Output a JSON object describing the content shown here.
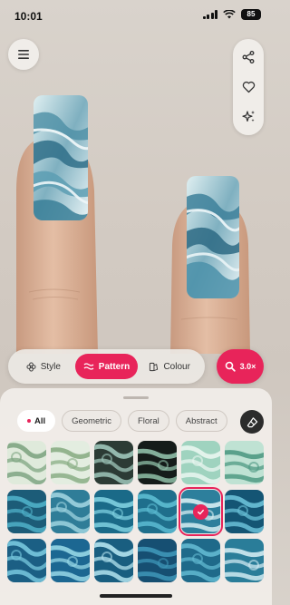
{
  "status_bar": {
    "time": "10:01",
    "battery": "85"
  },
  "toolbar": {
    "menu_icon": "hamburger-icon",
    "actions": [
      {
        "name": "share",
        "icon": "share-icon"
      },
      {
        "name": "favorite",
        "icon": "heart-icon"
      },
      {
        "name": "effects",
        "icon": "sparkles-icon"
      }
    ]
  },
  "mode_tabs": [
    {
      "label": "Style",
      "icon": "flower-icon",
      "active": false
    },
    {
      "label": "Pattern",
      "icon": "waves-icon",
      "active": true
    },
    {
      "label": "Colour",
      "icon": "palette-icon",
      "active": false
    }
  ],
  "zoom": {
    "label": "3.0×",
    "icon": "magnifier-icon"
  },
  "filters": [
    {
      "label": "All",
      "active": true
    },
    {
      "label": "Geometric",
      "active": false
    },
    {
      "label": "Floral",
      "active": false
    },
    {
      "label": "Abstract",
      "active": false
    }
  ],
  "eraser_icon": "eraser-icon",
  "patterns": {
    "rows": 3,
    "cols": 6,
    "selected_index": 10,
    "tile_colors": [
      [
        "#dfeadb",
        "#7fa582"
      ],
      [
        "#e3ede0",
        "#89ad85"
      ],
      [
        "#2c3b35",
        "#9fc7ba"
      ],
      [
        "#151c1a",
        "#8fbfa8"
      ],
      [
        "#9fd3bf",
        "#e9f6f0"
      ],
      [
        "#bfe2d3",
        "#4f9a83"
      ],
      [
        "#1c5c78",
        "#4fb0c8"
      ],
      [
        "#2f7d98",
        "#9ed3df"
      ],
      [
        "#1a6a88",
        "#7fd0e0"
      ],
      [
        "#1f6f8c",
        "#5cbcd2"
      ],
      [
        "#2d7f9c",
        "#d7eef3"
      ],
      [
        "#145574",
        "#6ac1d8"
      ],
      [
        "#1b5f84",
        "#78c8de"
      ],
      [
        "#1c6792",
        "#96d7e6"
      ],
      [
        "#195e80",
        "#b3e3ee"
      ],
      [
        "#164f72",
        "#3e96b8"
      ],
      [
        "#1f6a8a",
        "#62b9d0"
      ],
      [
        "#2a7d99",
        "#cfeaf1"
      ]
    ]
  }
}
